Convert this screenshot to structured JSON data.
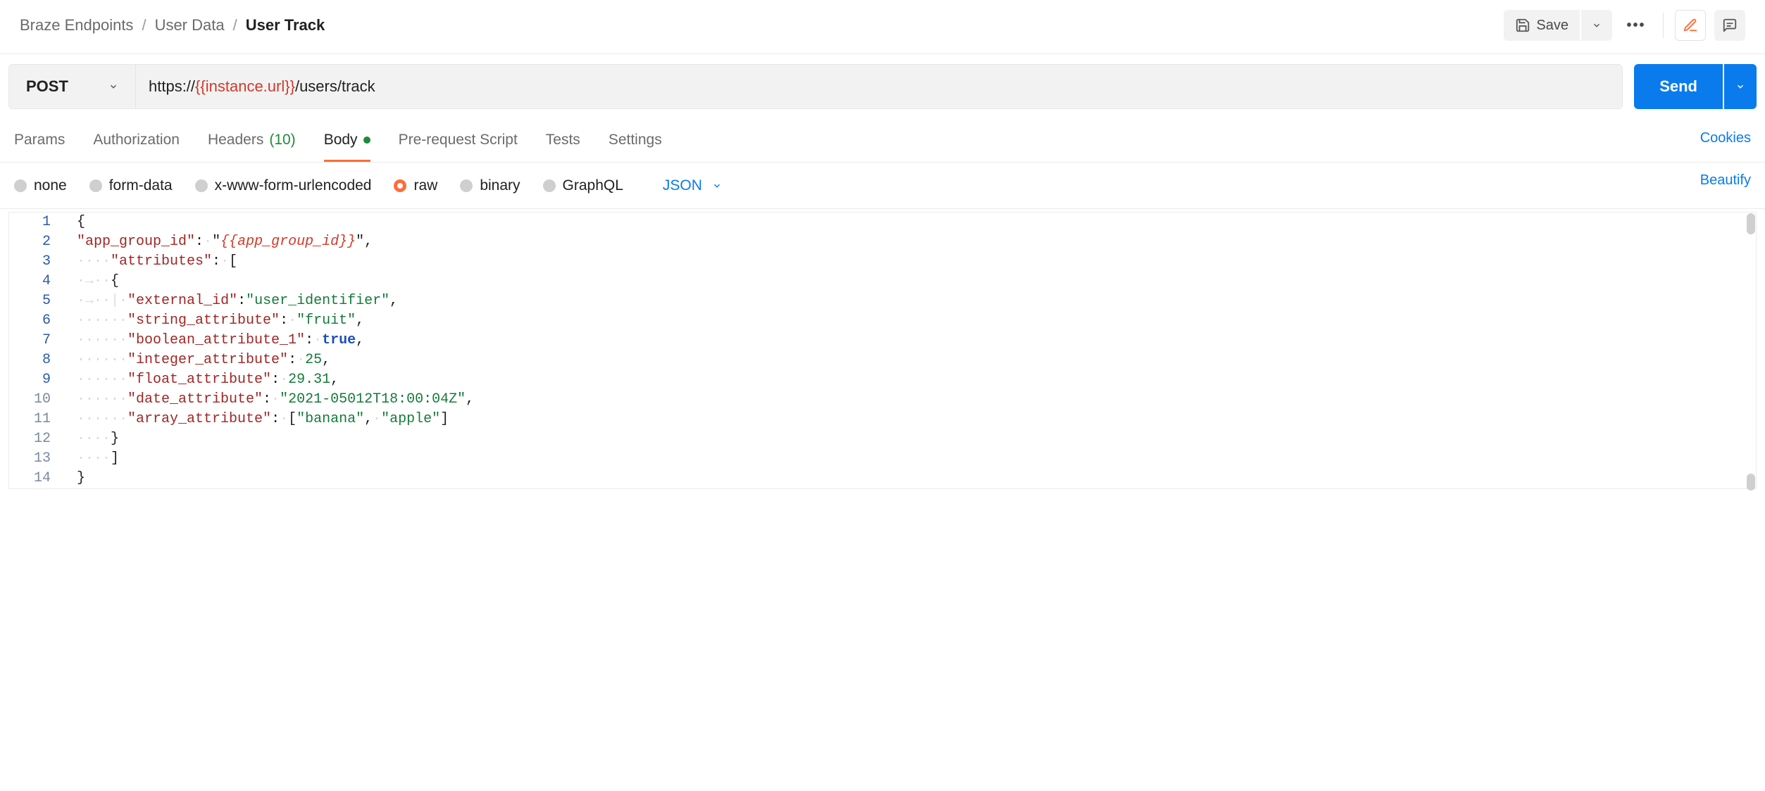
{
  "breadcrumb": {
    "root": "Braze Endpoints",
    "section": "User Data",
    "current": "User Track"
  },
  "header": {
    "save_label": "Save"
  },
  "request": {
    "method": "POST",
    "url_prefix": "https://",
    "url_var": "{{instance.url}}",
    "url_suffix": "/users/track",
    "send_label": "Send"
  },
  "tabs": {
    "params": "Params",
    "auth": "Authorization",
    "headers_label": "Headers",
    "headers_count": "(10)",
    "body": "Body",
    "prerequest": "Pre-request Script",
    "tests": "Tests",
    "settings": "Settings",
    "cookies": "Cookies"
  },
  "body_types": {
    "none": "none",
    "form_data": "form-data",
    "urlencoded": "x-www-form-urlencoded",
    "raw": "raw",
    "binary": "binary",
    "graphql": "GraphQL",
    "lang": "JSON",
    "beautify": "Beautify"
  },
  "editor": {
    "line_numbers": [
      "1",
      "2",
      "3",
      "4",
      "5",
      "6",
      "7",
      "8",
      "9",
      "10",
      "11",
      "12",
      "13",
      "14"
    ],
    "body_json": {
      "app_group_id": "{{app_group_id}}",
      "attributes": [
        {
          "external_id": "user_identifier",
          "string_attribute": "fruit",
          "boolean_attribute_1": true,
          "integer_attribute": 25,
          "float_attribute": 29.31,
          "date_attribute": "2021-05012T18:00:04Z",
          "array_attribute": [
            "banana",
            "apple"
          ]
        }
      ]
    },
    "tokens": {
      "k_app_group_id": "\"app_group_id\"",
      "v_app_group_id": "{{app_group_id}}",
      "k_attributes": "\"attributes\"",
      "k_external_id": "\"external_id\"",
      "v_external_id": "\"user_identifier\"",
      "k_string_attribute": "\"string_attribute\"",
      "v_string_attribute": "\"fruit\"",
      "k_boolean_attribute_1": "\"boolean_attribute_1\"",
      "v_boolean_attribute_1": "true",
      "k_integer_attribute": "\"integer_attribute\"",
      "v_integer_attribute": "25",
      "k_float_attribute": "\"float_attribute\"",
      "v_float_attribute": "29.31",
      "k_date_attribute": "\"date_attribute\"",
      "v_date_attribute": "\"2021-05012T18:00:04Z\"",
      "k_array_attribute": "\"array_attribute\"",
      "v_arr_0": "\"banana\"",
      "v_arr_1": "\"apple\""
    }
  }
}
